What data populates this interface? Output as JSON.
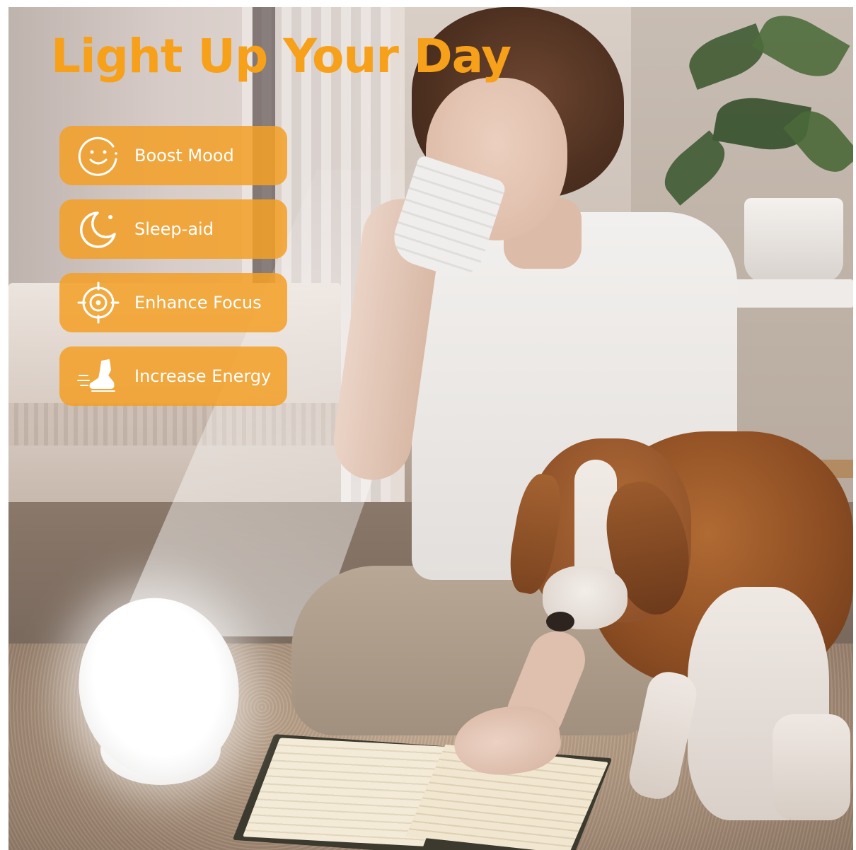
{
  "headline": "Light Up Your Day",
  "benefits": [
    {
      "label": "Boost Mood",
      "icon": "smiley-face-icon"
    },
    {
      "label": "Sleep-aid",
      "icon": "crescent-moon-icon"
    },
    {
      "label": "Enhance Focus",
      "icon": "target-icon"
    },
    {
      "label": "Increase Energy",
      "icon": "running-shoe-icon"
    }
  ],
  "colors": {
    "accent": "#f7a01a",
    "badge_background": "#f3a026",
    "badge_text": "#ffffff"
  }
}
